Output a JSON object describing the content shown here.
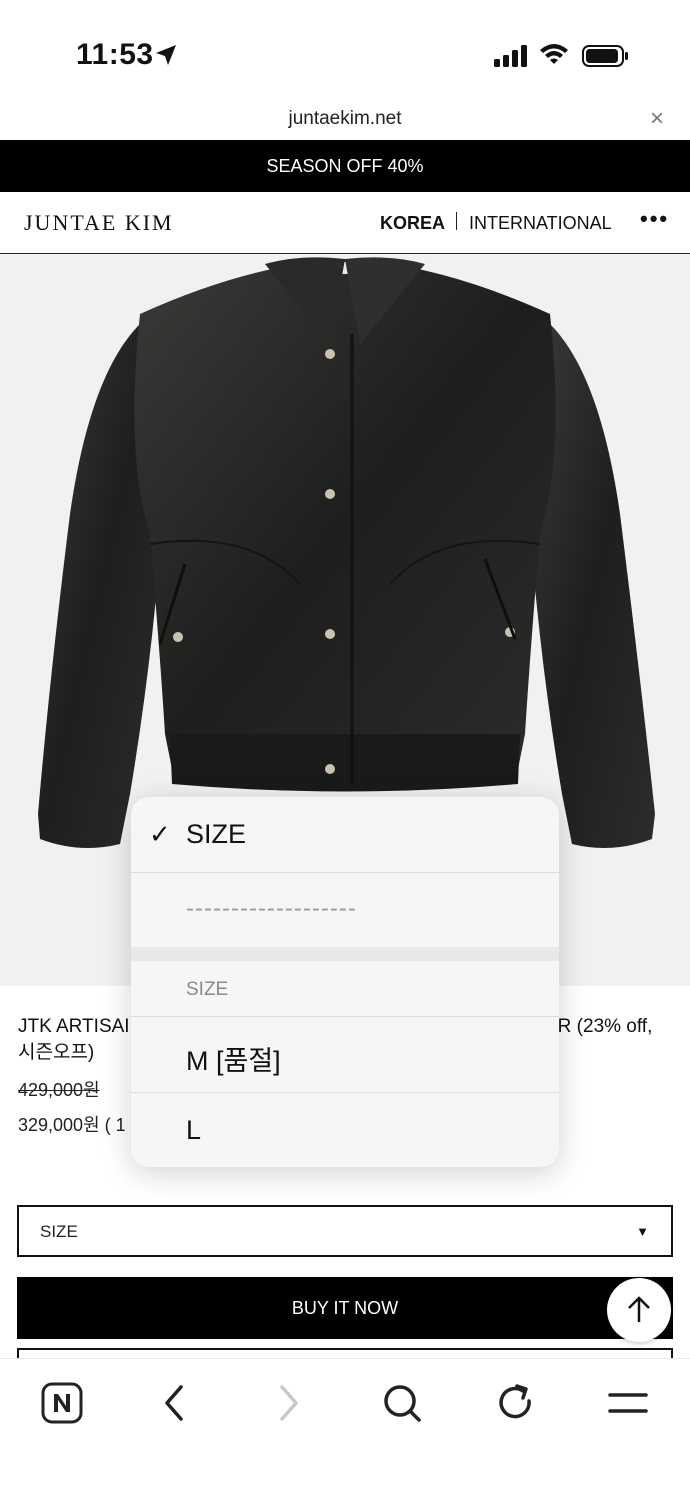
{
  "status_bar": {
    "time": "11:53"
  },
  "browser": {
    "url": "juntaekim.net",
    "close_label": "×"
  },
  "promo": {
    "text": "SEASON OFF 40%"
  },
  "header": {
    "logo": "JUNTAE KIM",
    "nav_korea": "KOREA",
    "nav_international": "INTERNATIONAL",
    "more_label": "•••"
  },
  "product": {
    "title": "JTK ARTISAN LEATHER JACKET ············· ER (23% off, 시즌오프)",
    "title_visible_left": "JTK ARTISAI",
    "title_visible_right": "ER (23% off,",
    "title_line2": "시즌오프)",
    "price_original": "429,000원",
    "price_sale": "329,000원 ( 1"
  },
  "size_select": {
    "label": "SIZE",
    "arrow": "▼"
  },
  "buy_button": {
    "label": "BUY IT NOW"
  },
  "dropdown": {
    "selected": "SIZE",
    "check": "✓",
    "separator": "-------------------",
    "group_header": "SIZE",
    "options": [
      "M [품절]",
      "L"
    ]
  },
  "icons": {
    "location": "location-arrow-icon",
    "signal": "cellular-signal-icon",
    "wifi": "wifi-icon",
    "battery": "battery-icon",
    "scroll_top": "arrow-up-icon",
    "toolbar": [
      "naver-icon",
      "back-icon",
      "forward-icon",
      "search-icon",
      "reload-icon",
      "menu-icon"
    ]
  },
  "colors": {
    "banner_bg": "#000000",
    "button_bg": "#000000",
    "forward_disabled": "#c8c8c8"
  }
}
